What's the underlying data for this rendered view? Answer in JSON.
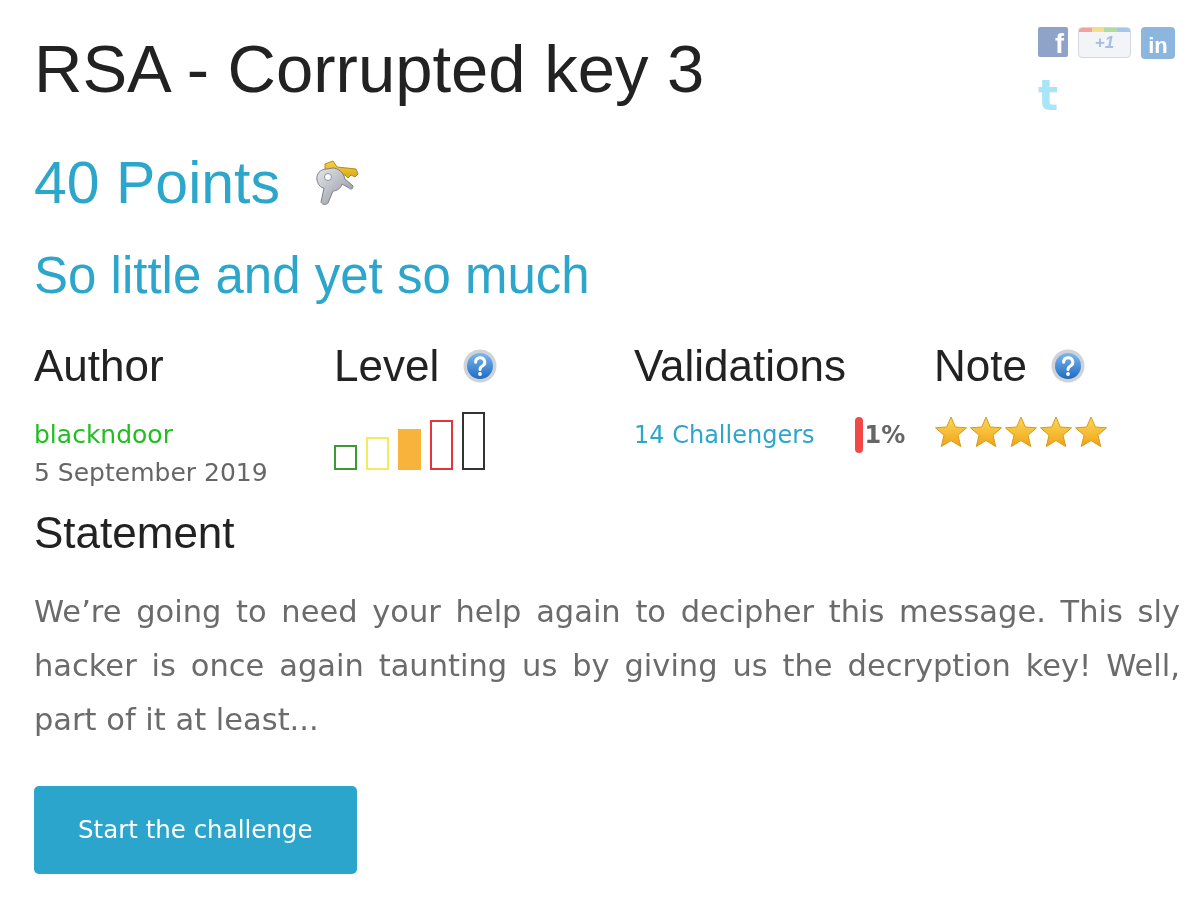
{
  "title": "RSA - Corrupted key 3",
  "share_buttons": [
    {
      "kind": "tile",
      "glyph": "f",
      "color": "#8fa3c9"
    },
    {
      "kind": "pill",
      "glyph": "+1",
      "color": "#a3bfe3"
    },
    {
      "kind": "tile",
      "glyph": "in",
      "color": "#8cb6de"
    },
    {
      "kind": "plain",
      "glyph": "t",
      "color": "#a9e4f7"
    }
  ],
  "points": "40 Points",
  "subtitle": "So little and yet so much",
  "columns": [
    {
      "kind": "author",
      "heading": "Author",
      "help": false,
      "name": "blackndoor",
      "date": "5 September 2019"
    },
    {
      "kind": "level",
      "heading": "Level",
      "help": true,
      "bars": [
        {
          "color": "#3d9a33",
          "selected": false
        },
        {
          "color": "#f2ec5c",
          "selected": false
        },
        {
          "color": "#f8b33d",
          "selected": true
        },
        {
          "color": "#e4353c",
          "selected": false
        },
        {
          "color": "#333333",
          "selected": false
        }
      ]
    },
    {
      "kind": "validations",
      "heading": "Validations",
      "help": false,
      "challengers": "14 Challengers",
      "percent": "1%"
    },
    {
      "kind": "note",
      "heading": "Note",
      "help": true,
      "stars": 5
    }
  ],
  "statement": {
    "heading": "Statement",
    "text": "We’re going to need your help again to decipher this message. This sly hacker is once again taunting us by giving us the decryption key! Well, part of it at least..."
  },
  "button": "Start the challenge"
}
